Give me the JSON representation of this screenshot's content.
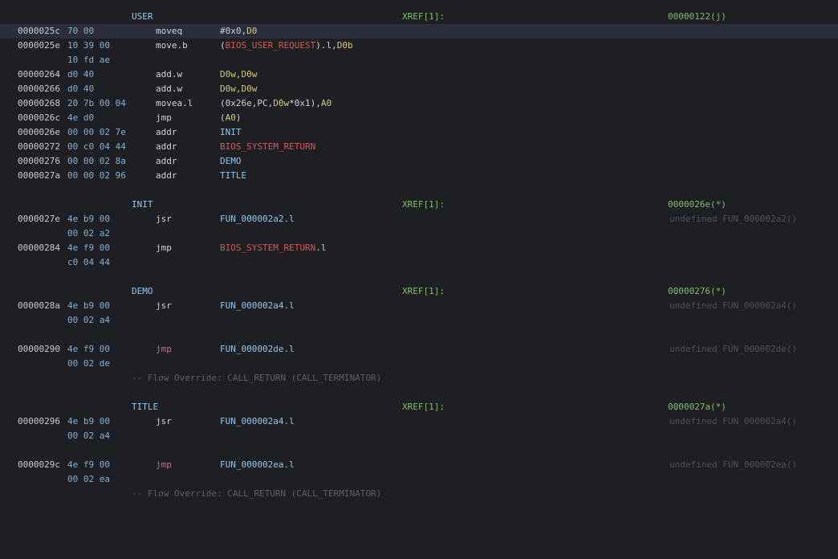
{
  "listing": {
    "user": {
      "label": "USER",
      "xref": "XREF[1]:",
      "xref_addr": "00000122(j)",
      "rows": [
        {
          "addr": "0000025c",
          "bytes": "70 00",
          "mnem": "moveq",
          "ops": [
            {
              "t": "#0x0,",
              "c": "pun"
            },
            {
              "t": "D0",
              "c": "reg"
            }
          ]
        },
        {
          "addr": "0000025e",
          "bytes": "10 39 00",
          "mnem": "move.b",
          "ops": [
            {
              "t": "(",
              "c": "pun"
            },
            {
              "t": "BIOS_USER_REQUEST",
              "c": "sym"
            },
            {
              "t": ").l,",
              "c": "pun"
            },
            {
              "t": "D0b",
              "c": "reg"
            }
          ]
        },
        {
          "addr": "",
          "bytes": "10 fd ae",
          "mnem": "",
          "ops": []
        },
        {
          "addr": "00000264",
          "bytes": "d0 40",
          "mnem": "add.w",
          "ops": [
            {
              "t": "D0w,D0w",
              "c": "reg"
            }
          ]
        },
        {
          "addr": "00000266",
          "bytes": "d0 40",
          "mnem": "add.w",
          "ops": [
            {
              "t": "D0w,D0w",
              "c": "reg"
            }
          ]
        },
        {
          "addr": "00000268",
          "bytes": "20 7b 00 04",
          "mnem": "movea.l",
          "ops": [
            {
              "t": "(0x26e,PC,",
              "c": "pun"
            },
            {
              "t": "D0w",
              "c": "reg"
            },
            {
              "t": "*0x1),",
              "c": "pun"
            },
            {
              "t": "A0",
              "c": "reg"
            }
          ]
        },
        {
          "addr": "0000026c",
          "bytes": "4e d0",
          "mnem": "jmp",
          "ops": [
            {
              "t": "(",
              "c": "pun"
            },
            {
              "t": "A0",
              "c": "reg"
            },
            {
              "t": ")",
              "c": "pun"
            }
          ]
        },
        {
          "addr": "0000026e",
          "bytes": "00 00 02 7e",
          "mnem": "addr",
          "ops": [
            {
              "t": "INIT",
              "c": "lbl"
            }
          ]
        },
        {
          "addr": "00000272",
          "bytes": "00 c0 04 44",
          "mnem": "addr",
          "ops": [
            {
              "t": "BIOS_SYSTEM_RETURN",
              "c": "sym"
            }
          ]
        },
        {
          "addr": "00000276",
          "bytes": "00 00 02 8a",
          "mnem": "addr",
          "ops": [
            {
              "t": "DEMO",
              "c": "lbl"
            }
          ]
        },
        {
          "addr": "0000027a",
          "bytes": "00 00 02 96",
          "mnem": "addr",
          "ops": [
            {
              "t": "TITLE",
              "c": "lbl"
            }
          ]
        }
      ]
    },
    "init": {
      "label": "INIT",
      "xref": "XREF[1]:",
      "xref_addr": "0000026e(*)",
      "rows": [
        {
          "addr": "0000027e",
          "bytes": "4e b9 00",
          "mnem": "jsr",
          "ops": [
            {
              "t": "FUN_000002a2.l",
              "c": "fun"
            }
          ],
          "sig": "undefined FUN_000002a2()"
        },
        {
          "addr": "",
          "bytes": "00 02 a2",
          "mnem": "",
          "ops": []
        },
        {
          "addr": "00000284",
          "bytes": "4e f9 00",
          "mnem": "jmp",
          "ops": [
            {
              "t": "BIOS_SYSTEM_RETURN",
              "c": "sym"
            },
            {
              "t": ".l",
              "c": "pun"
            }
          ]
        },
        {
          "addr": "",
          "bytes": "c0 04 44",
          "mnem": "",
          "ops": []
        }
      ]
    },
    "demo": {
      "label": "DEMO",
      "xref": "XREF[1]:",
      "xref_addr": "00000276(*)",
      "rows": [
        {
          "addr": "0000028a",
          "bytes": "4e b9 00",
          "mnem": "jsr",
          "ops": [
            {
              "t": "FUN_000002a4.l",
              "c": "fun"
            }
          ],
          "sig": "undefined FUN_000002a4()"
        },
        {
          "addr": "",
          "bytes": "00 02 a4",
          "mnem": "",
          "ops": []
        },
        {
          "addr": "00000290",
          "bytes": "4e f9 00",
          "mnem": "jmp",
          "ops": [
            {
              "t": "FUN_000002de.l",
              "c": "fun"
            }
          ],
          "sig": "undefined FUN_000002de()",
          "mnem_class": "jmp-red"
        },
        {
          "addr": "",
          "bytes": "00 02 de",
          "mnem": "",
          "ops": []
        }
      ],
      "comment": "-- Flow Override: CALL_RETURN (CALL_TERMINATOR)"
    },
    "title": {
      "label": "TITLE",
      "xref": "XREF[1]:",
      "xref_addr": "0000027a(*)",
      "rows": [
        {
          "addr": "00000296",
          "bytes": "4e b9 00",
          "mnem": "jsr",
          "ops": [
            {
              "t": "FUN_000002a4.l",
              "c": "fun"
            }
          ],
          "sig": "undefined FUN_000002a4()"
        },
        {
          "addr": "",
          "bytes": "00 02 a4",
          "mnem": "",
          "ops": []
        },
        {
          "addr": "0000029c",
          "bytes": "4e f9 00",
          "mnem": "jmp",
          "ops": [
            {
              "t": "FUN_000002ea.l",
              "c": "fun"
            }
          ],
          "sig": "undefined FUN_000002ea()",
          "mnem_class": "jmp-red"
        },
        {
          "addr": "",
          "bytes": "00 02 ea",
          "mnem": "",
          "ops": []
        }
      ],
      "comment": "-- Flow Override: CALL_RETURN (CALL_TERMINATOR)"
    }
  }
}
